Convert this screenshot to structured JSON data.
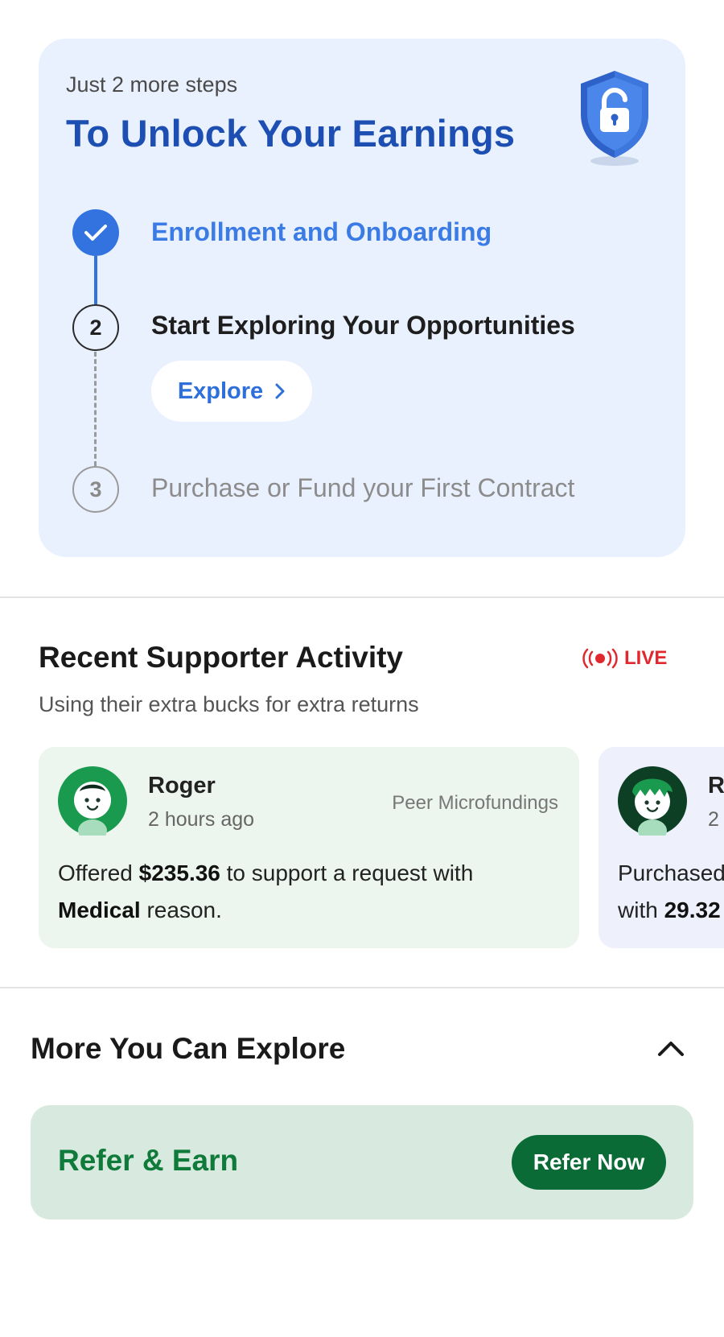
{
  "unlock": {
    "subtitle": "Just 2 more steps",
    "title": "To Unlock Your Earnings",
    "steps": [
      {
        "number": "1",
        "label": "Enrollment and Onboarding",
        "status": "completed"
      },
      {
        "number": "2",
        "label": "Start Exploring Your Opportunities",
        "status": "current"
      },
      {
        "number": "3",
        "label": "Purchase or Fund your First Contract",
        "status": "pending"
      }
    ],
    "explore_button": "Explore"
  },
  "activity": {
    "title": "Recent Supporter Activity",
    "live_label": "LIVE",
    "subtitle": "Using their extra bucks for extra returns",
    "cards": [
      {
        "name": "Roger",
        "time": "2 hours ago",
        "category": "Peer Microfundings",
        "text_prefix": "Offered ",
        "amount": "$235.36",
        "text_middle": " to support a request with ",
        "reason": "Medical",
        "text_suffix": " reason."
      },
      {
        "name": "R",
        "time": "2",
        "text_line1": "Purchased",
        "text_prefix": "with ",
        "amount": "29.32"
      }
    ]
  },
  "more": {
    "title": "More You Can Explore",
    "refer_title": "Refer & Earn",
    "refer_button": "Refer Now"
  },
  "colors": {
    "accent_blue": "#3273e0",
    "title_blue": "#1d4fb3",
    "card_bg": "#eaf1fe",
    "live_red": "#e0282e",
    "refer_green": "#0b6b36",
    "refer_bg": "#d8eadf"
  },
  "icons": [
    "shield-lock-icon",
    "checkmark-icon",
    "chevron-right-icon",
    "live-broadcast-icon",
    "avatar-icon",
    "chevron-up-icon"
  ]
}
